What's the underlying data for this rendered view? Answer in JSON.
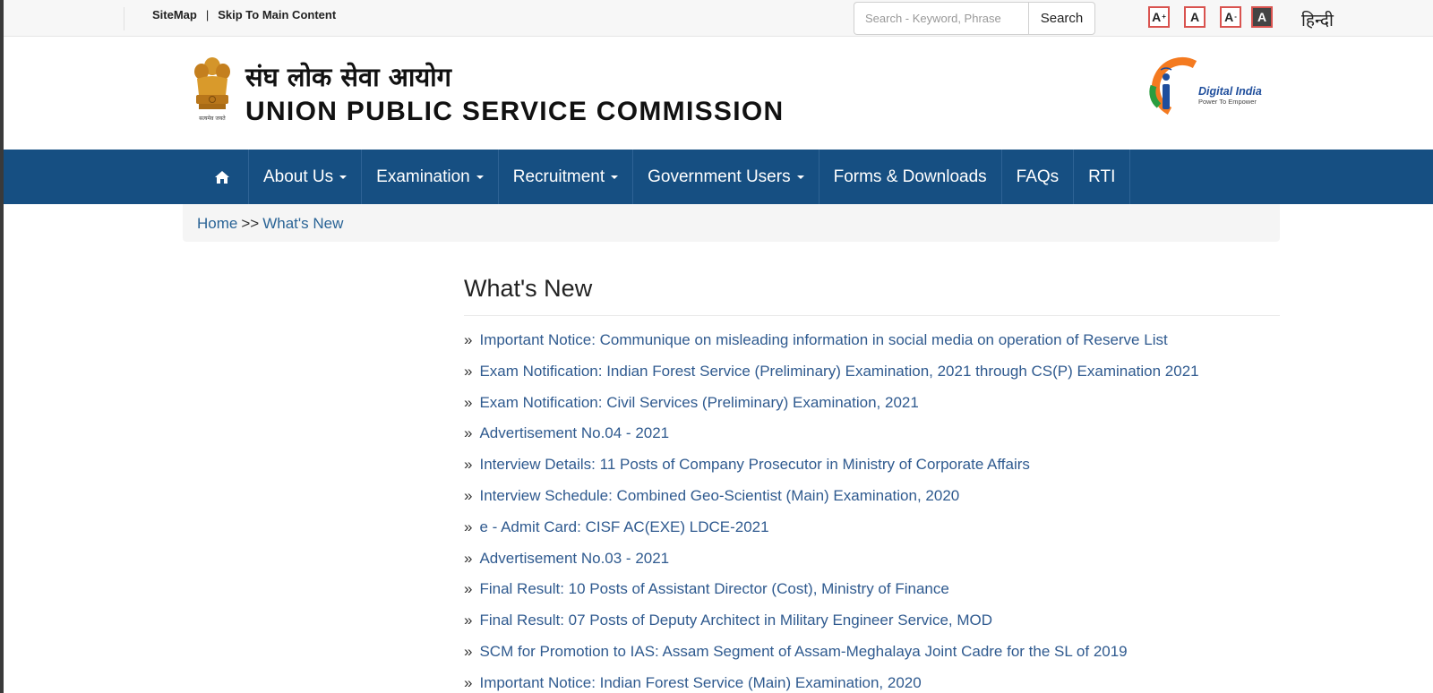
{
  "topbar": {
    "sitemap": "SiteMap",
    "separator": "|",
    "skip": "Skip To Main Content",
    "search_placeholder": "Search - Keyword, Phrase",
    "search_button": "Search",
    "font_increase": "A",
    "font_normal": "A",
    "font_decrease": "A",
    "font_contrast": "A",
    "sup_plus": "+",
    "sup_minus": "-",
    "language": "हिन्दी"
  },
  "header": {
    "title_hindi": "संघ लोक सेवा आयोग",
    "title_english": "UNION PUBLIC SERVICE COMMISSION",
    "emblem_motto": "सत्यमेव जयते",
    "digital_india": "Digital India",
    "digital_india_tagline": "Power To Empower"
  },
  "nav": {
    "home_icon": "home-icon",
    "items": [
      {
        "label": "About Us",
        "dropdown": true
      },
      {
        "label": "Examination",
        "dropdown": true
      },
      {
        "label": "Recruitment",
        "dropdown": true
      },
      {
        "label": "Government Users",
        "dropdown": true
      },
      {
        "label": "Forms & Downloads",
        "dropdown": false
      },
      {
        "label": "FAQs",
        "dropdown": false
      },
      {
        "label": "RTI",
        "dropdown": false
      }
    ]
  },
  "breadcrumb": {
    "home": "Home",
    "separator": ">>",
    "current": "What's New"
  },
  "main": {
    "title": "What's New",
    "bullet": "»",
    "items": [
      "Important Notice: Communique on misleading information in social media on operation of Reserve List",
      "Exam Notification: Indian Forest Service (Preliminary) Examination, 2021 through CS(P) Examination 2021",
      "Exam Notification: Civil Services (Preliminary) Examination, 2021",
      "Advertisement No.04 - 2021",
      "Interview Details: 11 Posts of Company Prosecutor in Ministry of Corporate Affairs",
      "Interview Schedule: Combined Geo-Scientist (Main) Examination, 2020",
      "e - Admit Card: CISF AC(EXE) LDCE-2021",
      "Advertisement No.03 - 2021",
      "Final Result: 10 Posts of Assistant Director (Cost), Ministry of Finance",
      "Final Result: 07 Posts of Deputy Architect in Military Engineer Service, MOD",
      "SCM for Promotion to IAS: Assam Segment of Assam-Meghalaya Joint Cadre for the SL of 2019",
      "Important Notice: Indian Forest Service (Main) Examination, 2020"
    ]
  },
  "colors": {
    "nav_background": "#164f82",
    "link": "#2f5a8f",
    "font_button_border": "#d9534f"
  }
}
